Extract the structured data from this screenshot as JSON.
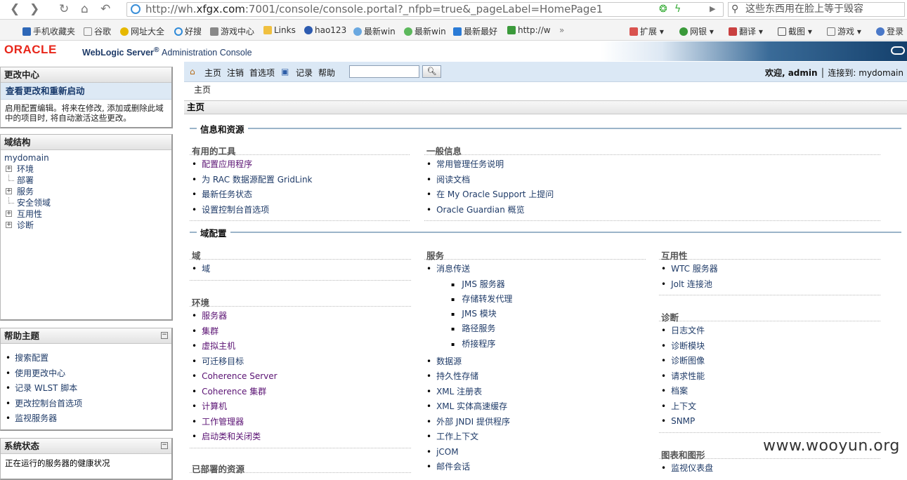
{
  "browser": {
    "url_prefix": "http://wh.",
    "url_host": "xfgx.com",
    "url_rest": ":7001/console/console.portal?_nfpb=true&_pageLabel=HomePage1",
    "search_text": "这些东西用在脸上等于毁容",
    "bookmarks": [
      "手机收藏夹",
      "谷歌",
      "网址大全",
      "好搜",
      "游戏中心",
      "Links",
      "hao123",
      "最新win",
      "最新win",
      "最新最好",
      "http://w"
    ],
    "tools": [
      "扩展",
      "网银",
      "翻译",
      "截图",
      "游戏",
      "登录"
    ]
  },
  "header": {
    "brand": "ORACLE",
    "product": "WebLogic Server",
    "reg": "®",
    "subtitle": "Administration Console"
  },
  "change_center": {
    "title": "更改中心",
    "link": "查看更改和重新启动",
    "desc": "启用配置编辑。将来在修改, 添加或删除此域中的项目时, 将自动激活这些更改。"
  },
  "domain_structure": {
    "title": "域结构",
    "root": "mydomain",
    "items": [
      "环境",
      "部署",
      "服务",
      "安全领域",
      "互用性",
      "诊断"
    ]
  },
  "help": {
    "title": "帮助主题",
    "items": [
      "搜索配置",
      "使用更改中心",
      "记录 WLST 脚本",
      "更改控制台首选项",
      "监视服务器"
    ]
  },
  "system_status": {
    "title": "系统状态",
    "text": "正在运行的服务器的健康状况"
  },
  "toolbar": {
    "home": "主页",
    "logout": "注销",
    "prefs": "首选项",
    "record": "记录",
    "help": "帮助",
    "welcome": "欢迎, admin",
    "connected": "连接到: mydomain"
  },
  "breadcrumb": "主页",
  "main": {
    "title": "主页",
    "sections": {
      "info": "信息和资源",
      "domain": "域配置"
    },
    "tools": {
      "title": "有用的工具",
      "items": [
        "配置应用程序",
        "为 RAC 数据源配置 GridLink",
        "最新任务状态",
        "设置控制台首选项"
      ]
    },
    "general": {
      "title": "一般信息",
      "items": [
        "常用管理任务说明",
        "阅读文档",
        "在 My Oracle Support 上提问",
        "Oracle Guardian 概览"
      ]
    },
    "domain_grp": {
      "title": "域",
      "items": [
        "域"
      ]
    },
    "env": {
      "title": "环境",
      "items": [
        "服务器",
        "集群",
        "虚拟主机",
        "可迁移目标",
        "Coherence Server",
        "Coherence 集群",
        "计算机",
        "工作管理器",
        "启动类和关闭类"
      ]
    },
    "deployed": {
      "title": "已部署的资源"
    },
    "services": {
      "title": "服务",
      "messaging": "消息传送",
      "messaging_sub": [
        "JMS 服务器",
        "存储转发代理",
        "JMS 模块",
        "路径服务",
        "桥接程序"
      ],
      "items": [
        "数据源",
        "持久性存储",
        "XML 注册表",
        "XML 实体高速缓存",
        "外部 JNDI 提供程序",
        "工作上下文",
        "jCOM",
        "邮件会话"
      ]
    },
    "interop": {
      "title": "互用性",
      "items": [
        "WTC 服务器",
        "Jolt 连接池"
      ]
    },
    "diag": {
      "title": "诊断",
      "items": [
        "日志文件",
        "诊断模块",
        "诊断图像",
        "请求性能",
        "档案",
        "上下文",
        "SNMP"
      ]
    },
    "charts": {
      "title": "图表和图形",
      "items": [
        "监视仪表盘"
      ]
    }
  },
  "watermark": "www.wooyun.org"
}
